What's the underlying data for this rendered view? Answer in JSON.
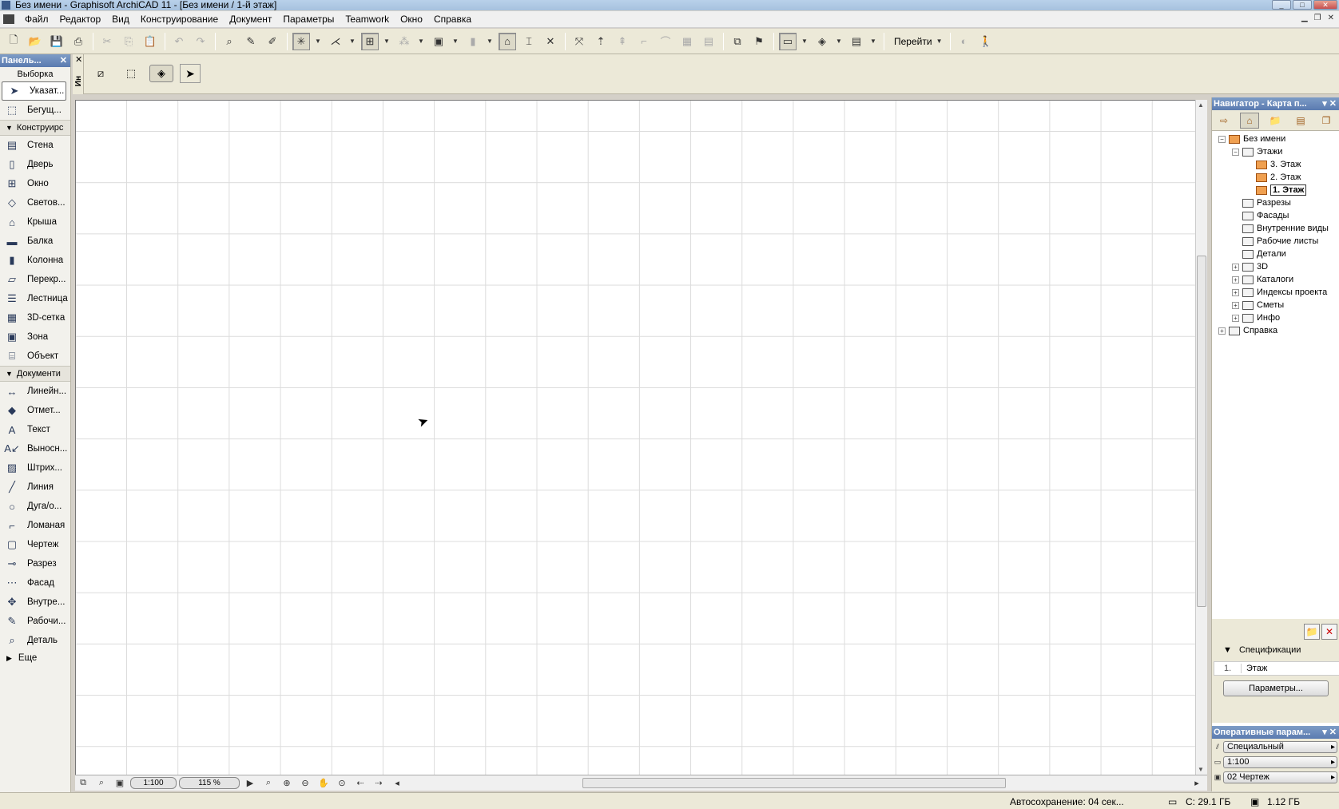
{
  "window": {
    "title": "Без имени - Graphisoft ArchiCAD 11 - [Без имени / 1-й этаж]"
  },
  "menu": [
    "Файл",
    "Редактор",
    "Вид",
    "Конструирование",
    "Документ",
    "Параметры",
    "Teamwork",
    "Окно",
    "Справка"
  ],
  "toolbar": {
    "goto_label": "Перейти"
  },
  "infobox": {
    "tab_label": "Ин"
  },
  "toolbox": {
    "title": "Панель...",
    "selection_label": "Выборка",
    "pointer": "Указат...",
    "marquee": "Бегущ...",
    "group_design": "Конструирс",
    "design_items": [
      {
        "label": "Стена",
        "icon": "wall-icon"
      },
      {
        "label": "Дверь",
        "icon": "door-icon"
      },
      {
        "label": "Окно",
        "icon": "window-icon"
      },
      {
        "label": "Светов...",
        "icon": "skylight-icon"
      },
      {
        "label": "Крыша",
        "icon": "roof-icon"
      },
      {
        "label": "Балка",
        "icon": "beam-icon"
      },
      {
        "label": "Колонна",
        "icon": "column-icon"
      },
      {
        "label": "Перекр...",
        "icon": "slab-icon"
      },
      {
        "label": "Лестница",
        "icon": "stair-icon"
      },
      {
        "label": "3D-сетка",
        "icon": "mesh-icon"
      },
      {
        "label": "Зона",
        "icon": "zone-icon"
      },
      {
        "label": "Объект",
        "icon": "object-icon"
      }
    ],
    "group_document": "Документи",
    "document_items": [
      {
        "label": "Линейн...",
        "icon": "dimension-icon"
      },
      {
        "label": "Отмет...",
        "icon": "level-dimension-icon"
      },
      {
        "label": "Текст",
        "icon": "text-icon"
      },
      {
        "label": "Выносн...",
        "icon": "label-icon"
      },
      {
        "label": "Штрих...",
        "icon": "fill-icon"
      },
      {
        "label": "Линия",
        "icon": "line-icon"
      },
      {
        "label": "Дуга/о...",
        "icon": "arc-icon"
      },
      {
        "label": "Ломаная",
        "icon": "polyline-icon"
      },
      {
        "label": "Чертеж",
        "icon": "drawing-icon"
      },
      {
        "label": "Разрез",
        "icon": "section-icon"
      },
      {
        "label": "Фасад",
        "icon": "elevation-icon"
      },
      {
        "label": "Внутре...",
        "icon": "interior-elevation-icon"
      },
      {
        "label": "Рабочи...",
        "icon": "worksheet-icon"
      },
      {
        "label": "Деталь",
        "icon": "detail-icon"
      }
    ],
    "more": "Еще"
  },
  "statusbar": {
    "scale": "1:100",
    "zoom": "115 %"
  },
  "navigator": {
    "title": "Навигатор - Карта п...",
    "tree": [
      {
        "label": "Без имени",
        "level": 0,
        "pm": "−",
        "icon": "project-icon",
        "orange": true
      },
      {
        "label": "Этажи",
        "level": 1,
        "pm": "−",
        "icon": "stories-icon",
        "orange": false
      },
      {
        "label": "3. Этаж",
        "level": 2,
        "pm": "",
        "icon": "story-icon",
        "orange": true
      },
      {
        "label": "2. Этаж",
        "level": 2,
        "pm": "",
        "icon": "story-icon",
        "orange": true
      },
      {
        "label": "1. Этаж",
        "level": 2,
        "pm": "",
        "icon": "story-icon",
        "orange": true,
        "selected": true
      },
      {
        "label": "Разрезы",
        "level": 1,
        "pm": "",
        "icon": "sections-icon",
        "orange": false
      },
      {
        "label": "Фасады",
        "level": 1,
        "pm": "",
        "icon": "elevations-icon",
        "orange": false
      },
      {
        "label": "Внутренние виды",
        "level": 1,
        "pm": "",
        "icon": "interior-views-icon",
        "orange": false
      },
      {
        "label": "Рабочие листы",
        "level": 1,
        "pm": "",
        "icon": "worksheets-icon",
        "orange": false
      },
      {
        "label": "Детали",
        "level": 1,
        "pm": "",
        "icon": "details-icon",
        "orange": false
      },
      {
        "label": "3D",
        "level": 1,
        "pm": "+",
        "icon": "3d-icon",
        "orange": false
      },
      {
        "label": "Каталоги",
        "level": 1,
        "pm": "+",
        "icon": "schedules-icon",
        "orange": false
      },
      {
        "label": "Индексы проекта",
        "level": 1,
        "pm": "+",
        "icon": "project-indexes-icon",
        "orange": false
      },
      {
        "label": "Сметы",
        "level": 1,
        "pm": "+",
        "icon": "lists-icon",
        "orange": false
      },
      {
        "label": "Инфо",
        "level": 1,
        "pm": "+",
        "icon": "info-icon",
        "orange": false
      },
      {
        "label": "Справка",
        "level": 0,
        "pm": "+",
        "icon": "help-icon",
        "orange": false
      }
    ],
    "spec_header": "Спецификации",
    "spec_number": "1.",
    "spec_value": "Этаж",
    "params_button": "Параметры..."
  },
  "quick_options": {
    "title": "Оперативные парам...",
    "rows": [
      "Специальный",
      "1:100",
      "02 Чертеж"
    ]
  },
  "app_status": {
    "autosave": "Автосохранение: 04 сек...",
    "disk": "С: 29.1 ГБ",
    "memory": "1.12 ГБ"
  }
}
